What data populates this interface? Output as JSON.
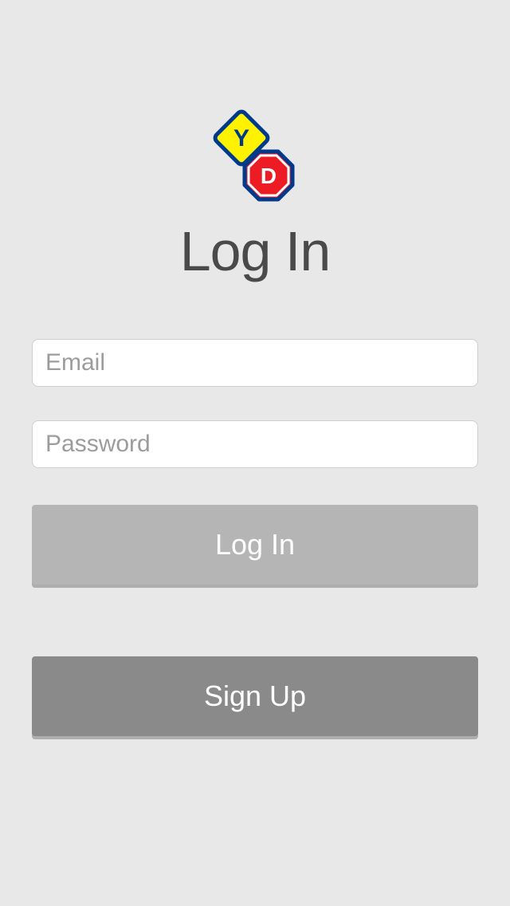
{
  "header": {
    "title": "Log In",
    "logo_letter_yellow": "Y",
    "logo_letter_red": "D"
  },
  "form": {
    "email": {
      "placeholder": "Email",
      "value": ""
    },
    "password": {
      "placeholder": "Password",
      "value": ""
    }
  },
  "buttons": {
    "login_label": "Log In",
    "signup_label": "Sign Up"
  },
  "colors": {
    "bg": "#e8e8e8",
    "title": "#4a4a4a",
    "btn_login": "#b5b5b5",
    "btn_signup": "#8a8a8a",
    "logo_yellow": "#fff200",
    "logo_red": "#ed1c24",
    "logo_blue": "#003a8c"
  }
}
